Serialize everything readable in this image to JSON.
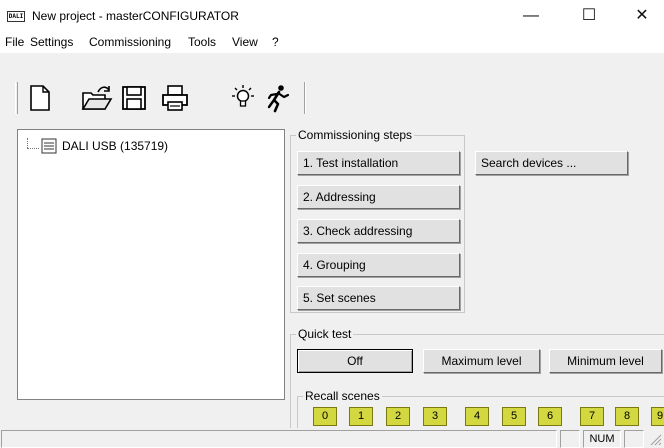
{
  "window": {
    "app_icon_text": "DALI",
    "title": "New project - masterCONFIGURATOR",
    "minimize_glyph": "—",
    "maximize_glyph": "☐",
    "close_glyph": "✕"
  },
  "menu": {
    "items": [
      "File",
      "Settings",
      "Commissioning",
      "Tools",
      "View",
      "?"
    ]
  },
  "toolbar": {
    "buttons": [
      "new-document-icon",
      "open-folder-icon",
      "save-disk-icon",
      "print-icon",
      "light-bulb-icon",
      "running-man-icon"
    ]
  },
  "tree": {
    "root_label": "DALI USB (135719)"
  },
  "commissioning": {
    "legend": "Commissioning steps",
    "steps": [
      "1. Test installation",
      "2. Addressing",
      "3. Check addressing",
      "4. Grouping",
      "5. Set scenes"
    ],
    "search_label": "Search devices ..."
  },
  "quick_test": {
    "legend": "Quick test",
    "off_label": "Off",
    "max_label": "Maximum level",
    "min_label": "Minimum level"
  },
  "recall_scenes": {
    "legend": "Recall scenes",
    "scenes": [
      "0",
      "1",
      "2",
      "3",
      "4",
      "5",
      "6",
      "7",
      "8",
      "9"
    ],
    "color": "#d4d840"
  },
  "statusbar": {
    "num_label": "NUM"
  }
}
